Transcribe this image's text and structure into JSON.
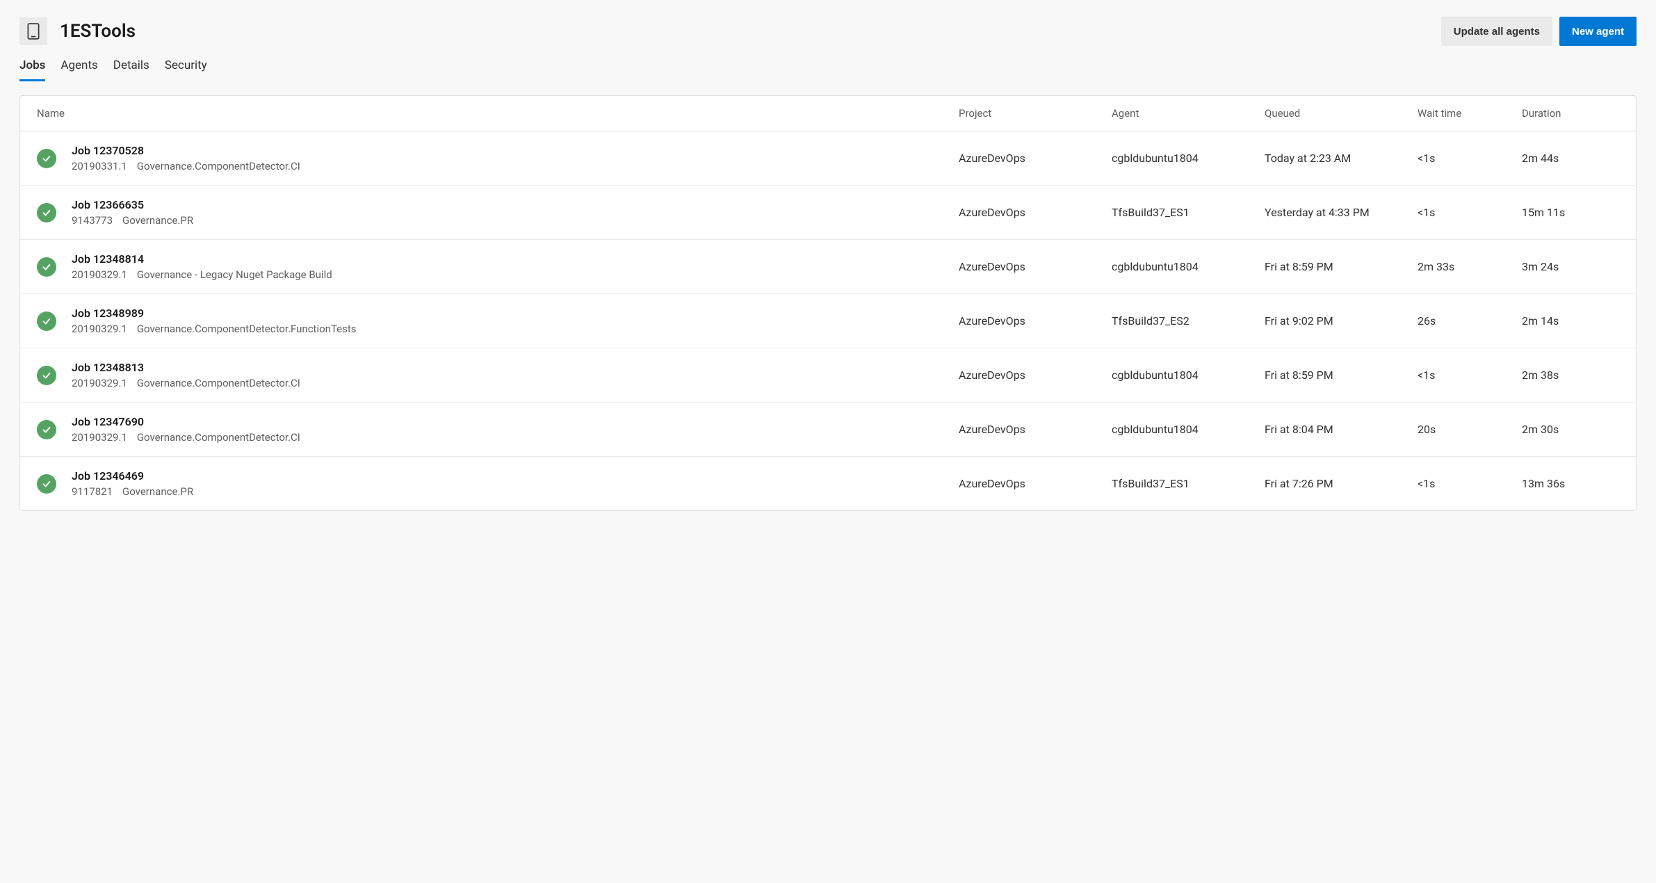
{
  "header": {
    "title": "1ESTools",
    "update_all_label": "Update all agents",
    "new_agent_label": "New agent"
  },
  "tabs": [
    {
      "label": "Jobs",
      "active": true
    },
    {
      "label": "Agents",
      "active": false
    },
    {
      "label": "Details",
      "active": false
    },
    {
      "label": "Security",
      "active": false
    }
  ],
  "columns": {
    "name": "Name",
    "project": "Project",
    "agent": "Agent",
    "queued": "Queued",
    "wait_time": "Wait time",
    "duration": "Duration"
  },
  "jobs": [
    {
      "status": "success",
      "name": "Job 12370528",
      "build_number": "20190331.1",
      "pipeline": "Governance.ComponentDetector.CI",
      "project": "AzureDevOps",
      "agent": "cgbldubuntu1804",
      "queued": "Today at 2:23 AM",
      "wait_time": "<1s",
      "duration": "2m 44s"
    },
    {
      "status": "success",
      "name": "Job 12366635",
      "build_number": "9143773",
      "pipeline": "Governance.PR",
      "project": "AzureDevOps",
      "agent": "TfsBuild37_ES1",
      "queued": "Yesterday at 4:33 PM",
      "wait_time": "<1s",
      "duration": "15m 11s"
    },
    {
      "status": "success",
      "name": "Job 12348814",
      "build_number": "20190329.1",
      "pipeline": "Governance - Legacy Nuget Package Build",
      "project": "AzureDevOps",
      "agent": "cgbldubuntu1804",
      "queued": "Fri at 8:59 PM",
      "wait_time": "2m 33s",
      "duration": "3m 24s"
    },
    {
      "status": "success",
      "name": "Job 12348989",
      "build_number": "20190329.1",
      "pipeline": "Governance.ComponentDetector.FunctionTests",
      "project": "AzureDevOps",
      "agent": "TfsBuild37_ES2",
      "queued": "Fri at 9:02 PM",
      "wait_time": "26s",
      "duration": "2m 14s"
    },
    {
      "status": "success",
      "name": "Job 12348813",
      "build_number": "20190329.1",
      "pipeline": "Governance.ComponentDetector.CI",
      "project": "AzureDevOps",
      "agent": "cgbldubuntu1804",
      "queued": "Fri at 8:59 PM",
      "wait_time": "<1s",
      "duration": "2m 38s"
    },
    {
      "status": "success",
      "name": "Job 12347690",
      "build_number": "20190329.1",
      "pipeline": "Governance.ComponentDetector.CI",
      "project": "AzureDevOps",
      "agent": "cgbldubuntu1804",
      "queued": "Fri at 8:04 PM",
      "wait_time": "20s",
      "duration": "2m 30s"
    },
    {
      "status": "success",
      "name": "Job 12346469",
      "build_number": "9117821",
      "pipeline": "Governance.PR",
      "project": "AzureDevOps",
      "agent": "TfsBuild37_ES1",
      "queued": "Fri at 7:26 PM",
      "wait_time": "<1s",
      "duration": "13m 36s"
    }
  ]
}
